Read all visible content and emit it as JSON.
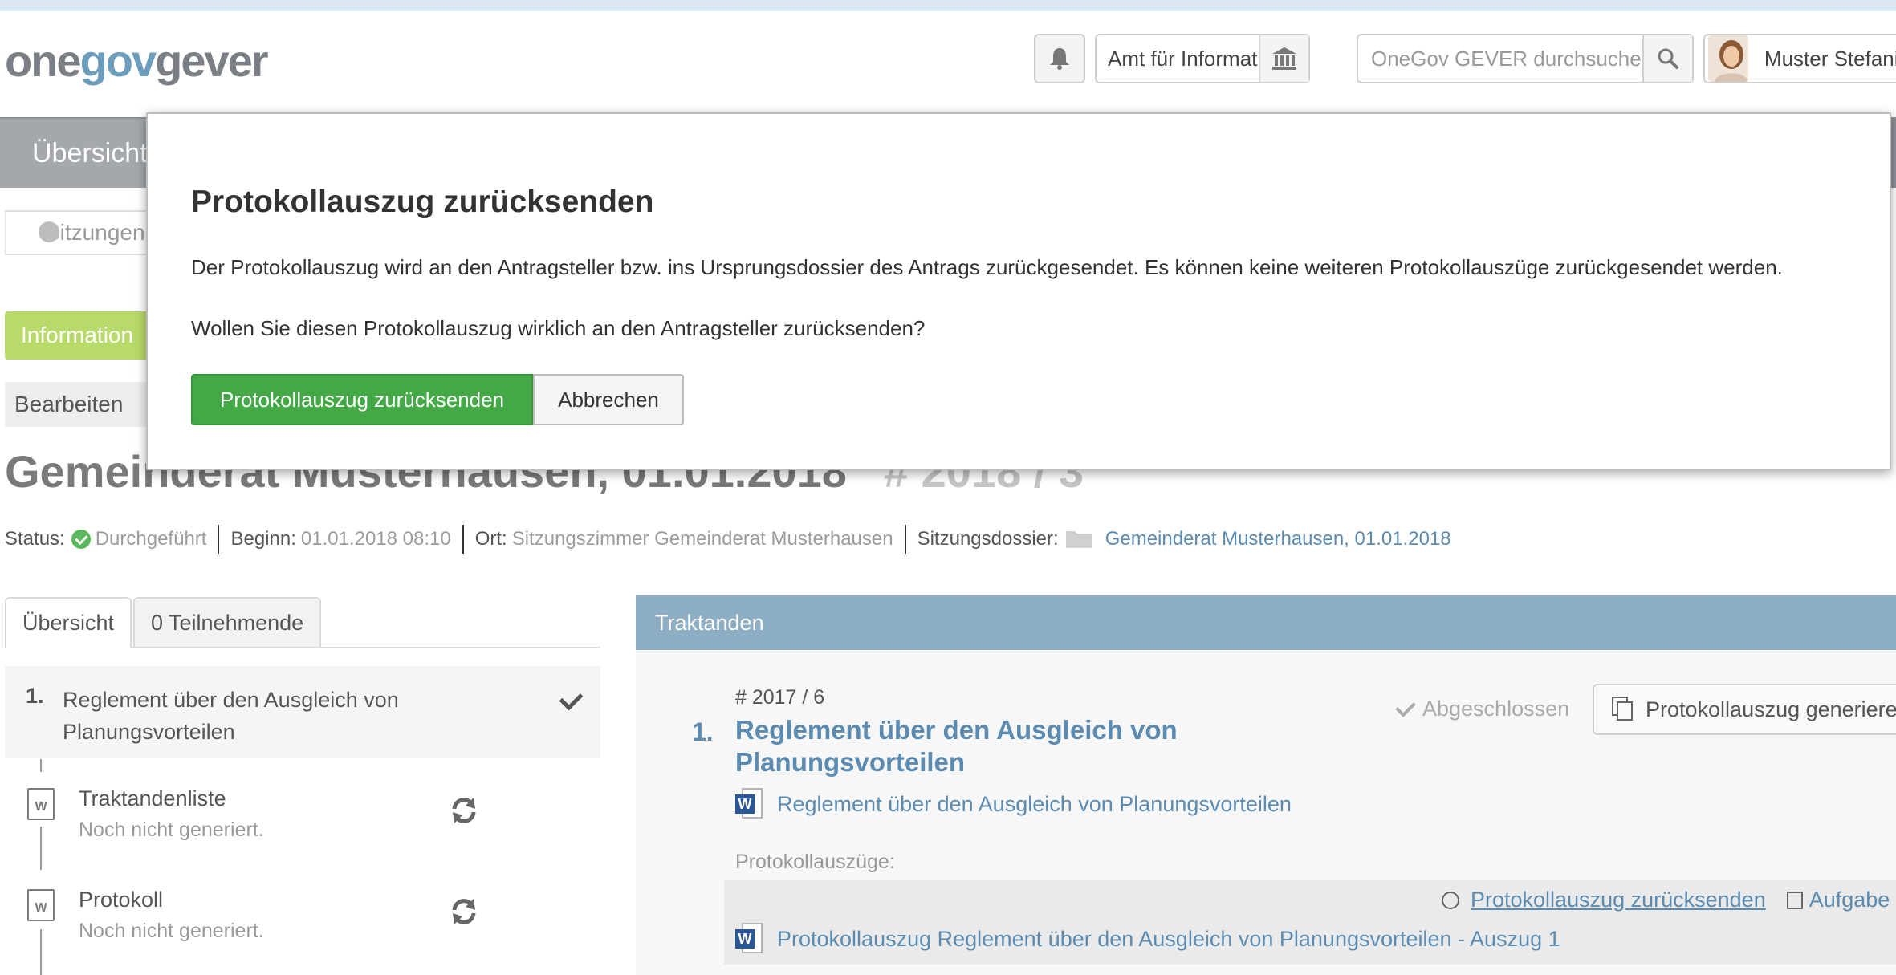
{
  "header": {
    "logo_part1": "one",
    "logo_part2": "gov",
    "logo_part3": "gever",
    "org_unit": "Amt für Informatik",
    "search_placeholder": "OneGov GEVER durchsuchen",
    "user_name": "Muster Stefanie"
  },
  "nav": {
    "overview_tab": "Übersicht",
    "breadcrumb_sitzung": "Sitzungen",
    "information_button": "Information",
    "edit_button": "Bearbeiten"
  },
  "meeting": {
    "title": "Gemeinderat Musterhausen, 01.01.2018",
    "number": "# 2018 / 3",
    "status_label": "Status:",
    "status_value": "Durchgeführt",
    "start_label": "Beginn:",
    "start_value": "01.01.2018 08:10",
    "location_label": "Ort:",
    "location_value": "Sitzungszimmer Gemeinderat Musterhausen",
    "dossier_label": "Sitzungsdossier:",
    "dossier_value": "Gemeinderat Musterhausen, 01.01.2018"
  },
  "left_tabs": {
    "overview": "Übersicht",
    "participants": "0 Teilnehmende"
  },
  "agenda_sidebar": {
    "item_number": "1.",
    "item_title": "Reglement über den Ausgleich von Planungsvorteilen",
    "docs": [
      {
        "name": "Traktandenliste",
        "status": "Noch nicht generiert."
      },
      {
        "name": "Protokoll",
        "status": "Noch nicht generiert."
      }
    ]
  },
  "traktanden": {
    "header": "Traktanden",
    "case_number": "# 2017 / 6",
    "item_number": "1.",
    "item_title": "Reglement über den Ausgleich von Planungsvorteilen",
    "state": "Abgeschlossen",
    "generate_button": "Protokollauszug generieren",
    "document_link": "Reglement über den Ausgleich von Planungsvorteilen",
    "extracts_label": "Protokollauszüge:",
    "return_link": "Protokollauszug zurücksenden",
    "task_link": "Aufgabe",
    "extract_document": "Protokollauszug Reglement über den Ausgleich von Planungsvorteilen - Auszug 1"
  },
  "dialog": {
    "title": "Protokollauszug zurücksenden",
    "text1": "Der Protokollauszug wird an den Antragsteller bzw. ins Ursprungsdossier des Antrags zurückgesendet. Es können keine weiteren Protokollauszüge zurückgesendet werden.",
    "text2": "Wollen Sie diesen Protokollauszug wirklich an den Antragsteller zurücksenden?",
    "confirm_button": "Protokollauszug zurücksenden",
    "cancel_button": "Abbrechen"
  },
  "colors": {
    "brand_blue": "#6c9dbd",
    "confirm_green": "#44a846",
    "info_green": "#b8da6a",
    "panel_header": "#8eaec4",
    "link_blue": "#5b8bb0"
  }
}
